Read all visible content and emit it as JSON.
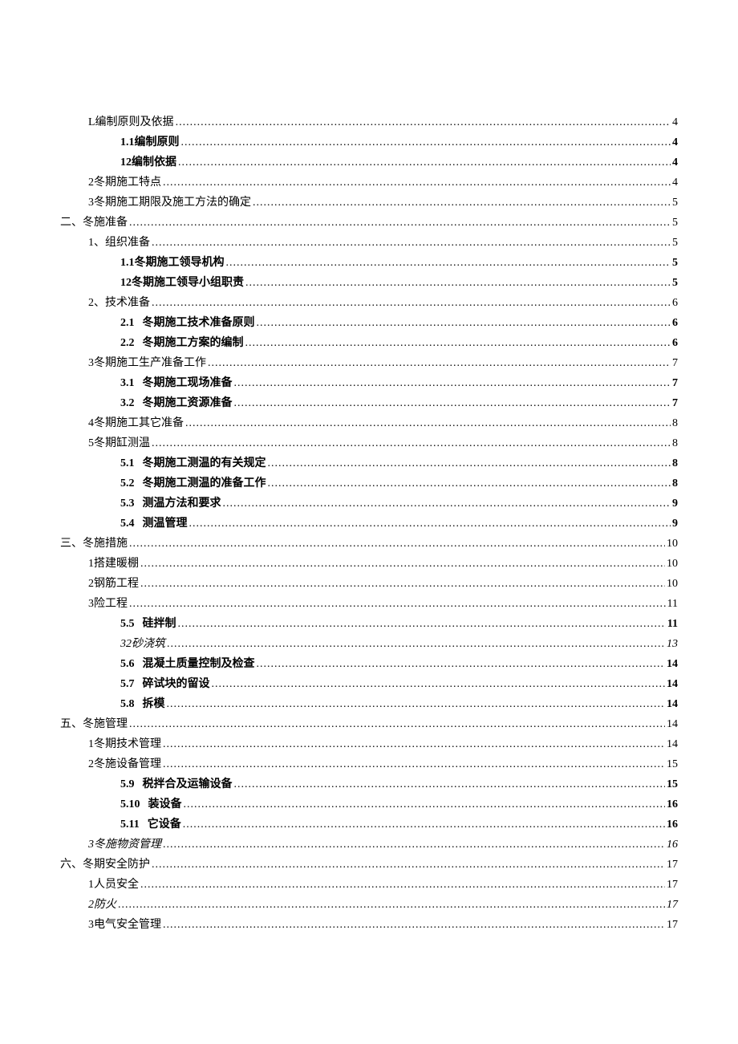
{
  "toc": [
    {
      "indent": 1,
      "bold": false,
      "italic": false,
      "prefix": "",
      "label": "L编制原则及依据",
      "page": "4"
    },
    {
      "indent": 2,
      "bold": true,
      "italic": false,
      "prefix": "",
      "label": "1.1编制原则",
      "page": "4"
    },
    {
      "indent": 2,
      "bold": true,
      "italic": false,
      "prefix": "",
      "label": "12编制依据",
      "page": "4"
    },
    {
      "indent": 1,
      "bold": false,
      "italic": false,
      "prefix": "",
      "label": "2冬期施工特点",
      "page": "4"
    },
    {
      "indent": 1,
      "bold": false,
      "italic": false,
      "prefix": "",
      "label": "3冬期施工期限及施工方法的确定",
      "page": "5"
    },
    {
      "indent": 0,
      "bold": false,
      "italic": false,
      "prefix": "",
      "label": "二、冬施准备",
      "page": "5"
    },
    {
      "indent": 1,
      "bold": false,
      "italic": false,
      "prefix": "",
      "label": "1、组织准备",
      "page": "5"
    },
    {
      "indent": 2,
      "bold": true,
      "italic": false,
      "prefix": "",
      "label": "1.1冬期施工领导机构",
      "page": "5"
    },
    {
      "indent": 2,
      "bold": true,
      "italic": false,
      "prefix": "",
      "label": "12冬期施工领导小组职责",
      "page": "5"
    },
    {
      "indent": 1,
      "bold": false,
      "italic": false,
      "prefix": "",
      "label": "2、技术准备",
      "page": "6"
    },
    {
      "indent": 2,
      "bold": true,
      "italic": false,
      "prefix": "2.1",
      "label": "冬期施工技术准备原则",
      "page": "6"
    },
    {
      "indent": 2,
      "bold": true,
      "italic": false,
      "prefix": "2.2",
      "label": "冬期施工方案的编制",
      "page": "6"
    },
    {
      "indent": 1,
      "bold": false,
      "italic": false,
      "prefix": "",
      "label": "3冬期施工生产准备工作",
      "page": "7"
    },
    {
      "indent": 2,
      "bold": true,
      "italic": false,
      "prefix": "3.1",
      "label": "冬期施工现场准备",
      "page": "7"
    },
    {
      "indent": 2,
      "bold": true,
      "italic": false,
      "prefix": "3.2",
      "label": "冬期施工资源准备",
      "page": "7"
    },
    {
      "indent": 1,
      "bold": false,
      "italic": false,
      "prefix": "",
      "label": "4冬期施工其它准备",
      "page": "8"
    },
    {
      "indent": 1,
      "bold": false,
      "italic": false,
      "prefix": "",
      "label": "5冬期缸测温",
      "page": "8"
    },
    {
      "indent": 2,
      "bold": true,
      "italic": false,
      "prefix": "5.1",
      "label": "冬期施工测温的有关规定",
      "page": "8"
    },
    {
      "indent": 2,
      "bold": true,
      "italic": false,
      "prefix": "5.2",
      "label": "冬期施工测温的准备工作",
      "page": "8"
    },
    {
      "indent": 2,
      "bold": true,
      "italic": false,
      "prefix": "5.3",
      "label": "测温方法和要求",
      "page": "9"
    },
    {
      "indent": 2,
      "bold": true,
      "italic": false,
      "prefix": "5.4",
      "label": "测温管理",
      "page": "9"
    },
    {
      "indent": 0,
      "bold": false,
      "italic": false,
      "prefix": "",
      "label": "三、冬施措施",
      "page": "10"
    },
    {
      "indent": 1,
      "bold": false,
      "italic": false,
      "prefix": "",
      "label": "1搭建暖棚",
      "page": "10"
    },
    {
      "indent": 1,
      "bold": false,
      "italic": false,
      "prefix": "",
      "label": "2钢筋工程",
      "page": "10"
    },
    {
      "indent": 1,
      "bold": false,
      "italic": false,
      "prefix": "",
      "label": "3险工程",
      "page": "11"
    },
    {
      "indent": 2,
      "bold": true,
      "italic": false,
      "prefix": "5.5",
      "label": "硅拌制",
      "page": "11"
    },
    {
      "indent": 2,
      "bold": false,
      "italic": true,
      "prefix": "",
      "label": "32砂浇筑",
      "page": "13"
    },
    {
      "indent": 2,
      "bold": true,
      "italic": false,
      "prefix": "5.6",
      "label": "混凝土质量控制及检查",
      "page": "14"
    },
    {
      "indent": 2,
      "bold": true,
      "italic": false,
      "prefix": "5.7",
      "label": "碎试块的留设",
      "page": "14"
    },
    {
      "indent": 2,
      "bold": true,
      "italic": false,
      "prefix": "5.8",
      "label": "拆模",
      "page": "14"
    },
    {
      "indent": 0,
      "bold": false,
      "italic": false,
      "prefix": "",
      "label": "五、冬施管理",
      "page": "14"
    },
    {
      "indent": 1,
      "bold": false,
      "italic": false,
      "prefix": "",
      "label": "1冬期技术管理",
      "page": "14"
    },
    {
      "indent": 1,
      "bold": false,
      "italic": false,
      "prefix": "",
      "label": "2冬施设备管理",
      "page": "15"
    },
    {
      "indent": 2,
      "bold": true,
      "italic": false,
      "prefix": "5.9",
      "label": "税拌合及运输设备",
      "page": "15"
    },
    {
      "indent": 2,
      "bold": true,
      "italic": false,
      "prefix": "5.10",
      "label": "装设备",
      "page": "16"
    },
    {
      "indent": 2,
      "bold": true,
      "italic": false,
      "prefix": "5.11",
      "label": "它设备",
      "page": "16"
    },
    {
      "indent": 1,
      "bold": false,
      "italic": true,
      "prefix": "",
      "label": "3冬施物资管理",
      "page": "16"
    },
    {
      "indent": 0,
      "bold": false,
      "italic": false,
      "prefix": "",
      "label": "六、冬期安全防护",
      "page": "17"
    },
    {
      "indent": 1,
      "bold": false,
      "italic": false,
      "prefix": "",
      "label": "1人员安全",
      "page": "17"
    },
    {
      "indent": 1,
      "bold": false,
      "italic": true,
      "prefix": "",
      "label": "2防火",
      "page": "17"
    },
    {
      "indent": 1,
      "bold": false,
      "italic": false,
      "prefix": "",
      "label": "3电气安全管理",
      "page": "17"
    }
  ]
}
